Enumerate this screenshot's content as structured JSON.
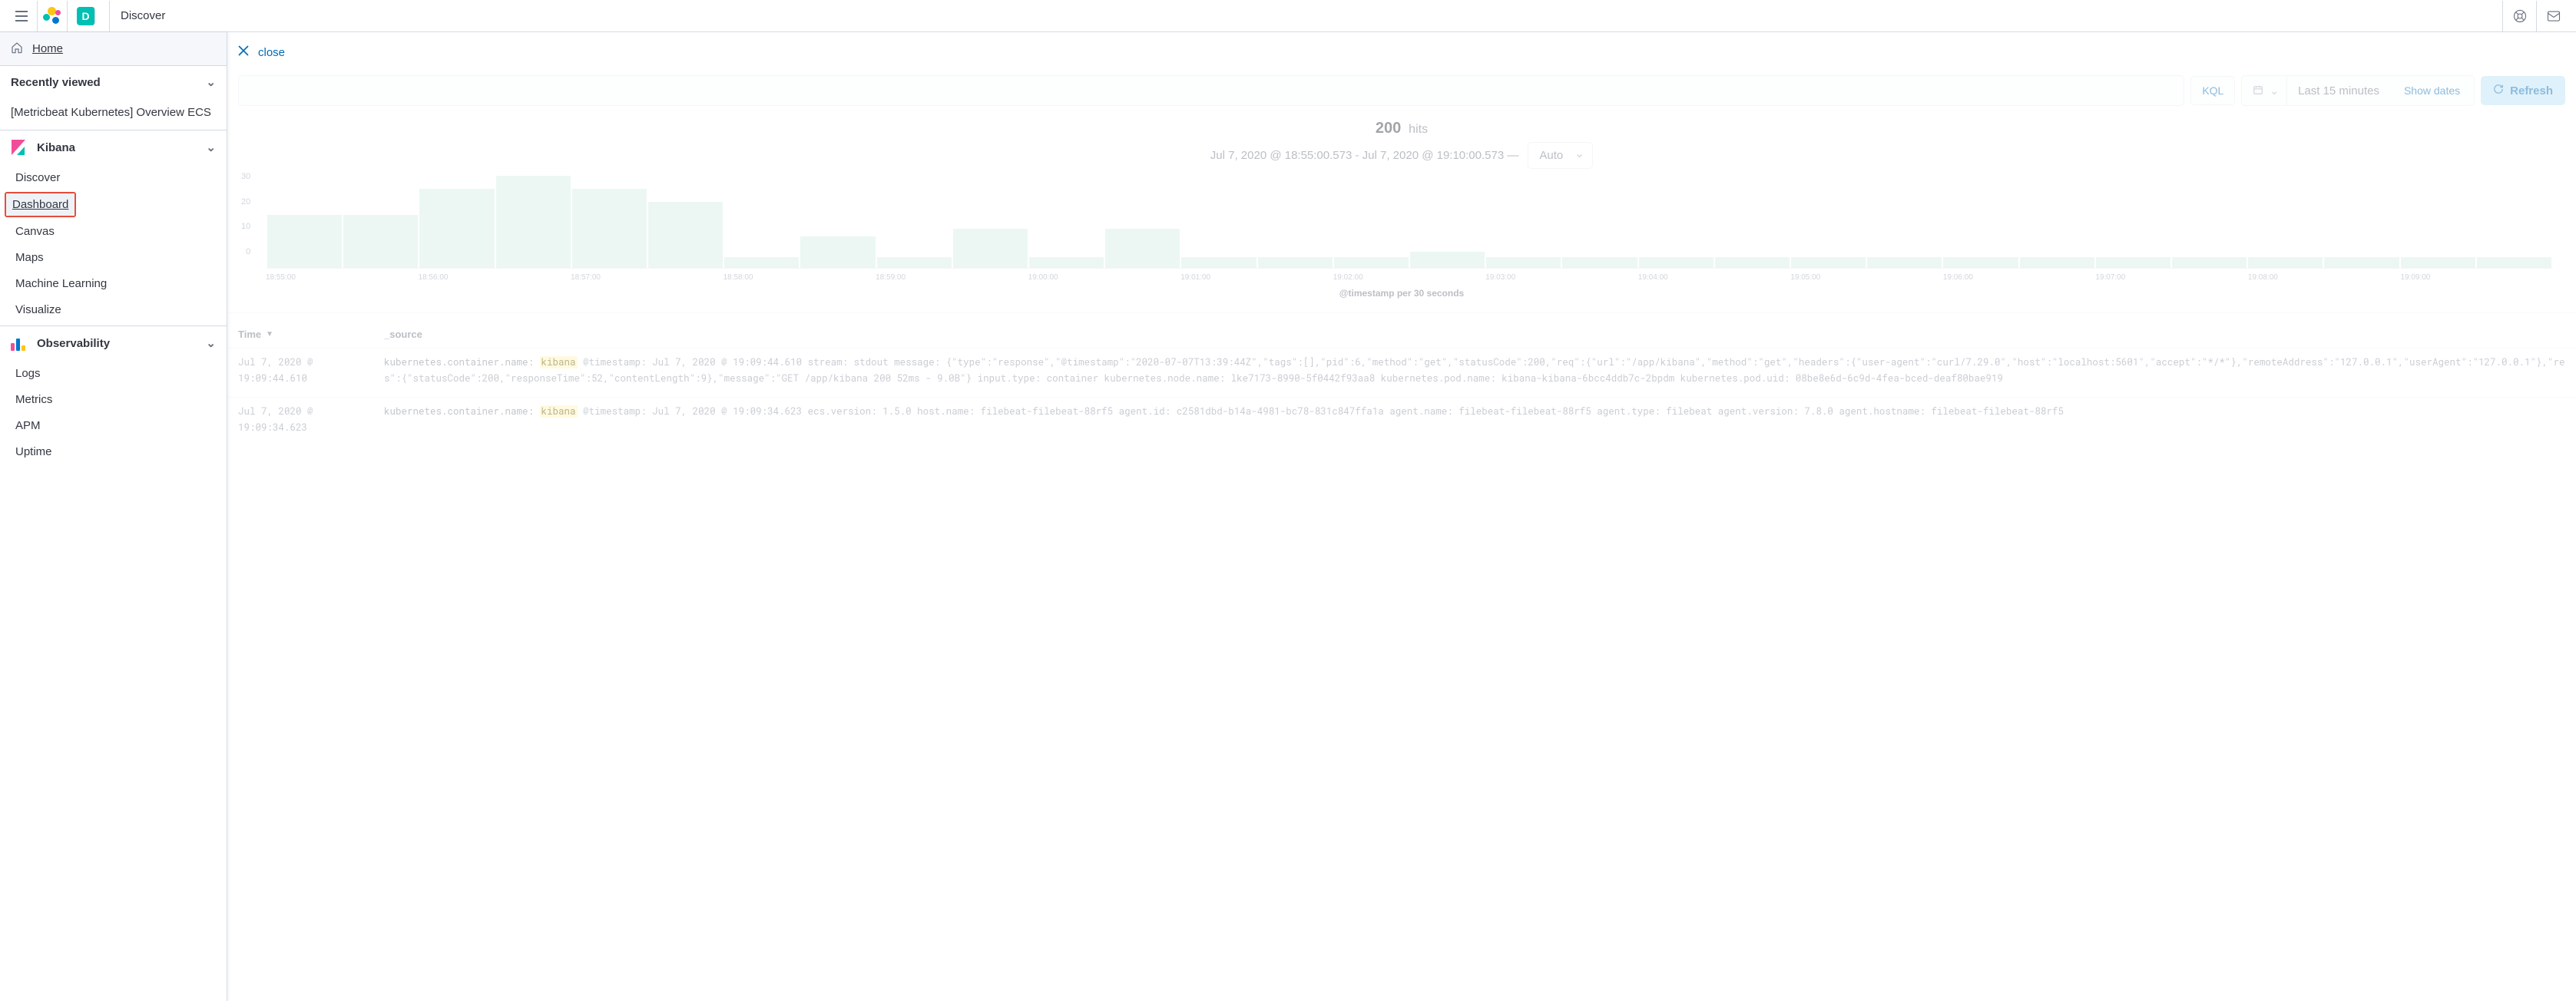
{
  "header": {
    "app_badge": "D",
    "app_name": "Discover"
  },
  "sidebar": {
    "home": "Home",
    "recently_viewed_label": "Recently viewed",
    "recent_items": [
      "[Metricbeat Kubernetes] Overview ECS"
    ],
    "kibana_label": "Kibana",
    "kibana_items": [
      "Discover",
      "Dashboard",
      "Canvas",
      "Maps",
      "Machine Learning",
      "Visualize"
    ],
    "observability_label": "Observability",
    "observability_items": [
      "Logs",
      "Metrics",
      "APM",
      "Uptime"
    ]
  },
  "close_label": "close",
  "query_bar": {
    "kql": "KQL",
    "time_text": "Last 15 minutes",
    "show_dates": "Show dates",
    "refresh": "Refresh"
  },
  "hits": {
    "count": "200",
    "label": "hits"
  },
  "range": {
    "text": "Jul 7, 2020 @ 18:55:00.573 - Jul 7, 2020 @ 19:10:00.573 —",
    "interval": "Auto"
  },
  "chart_data": {
    "type": "bar",
    "title": "",
    "xlabel": "@timestamp per 30 seconds",
    "ylabel": "",
    "ylim": [
      0,
      35
    ],
    "y_ticks": [
      "30",
      "20",
      "10",
      "0"
    ],
    "x_ticks": [
      "18:55:00",
      "18:56:00",
      "18:57:00",
      "18:58:00",
      "18:59:00",
      "19:00:00",
      "19:01:00",
      "19:02:00",
      "19:03:00",
      "19:04:00",
      "19:05:00",
      "19:06:00",
      "19:07:00",
      "19:08:00",
      "19:09:00"
    ],
    "values": [
      20,
      20,
      30,
      35,
      30,
      25,
      4,
      12,
      4,
      15,
      4,
      15,
      4,
      4,
      4,
      6,
      4,
      4,
      4,
      4,
      4,
      4,
      4,
      4,
      4,
      4,
      4,
      4,
      4,
      4
    ]
  },
  "table": {
    "col_time": "Time",
    "col_source": "_source",
    "rows": [
      {
        "time": "Jul 7, 2020 @ 19:09:44.610",
        "source_parts": [
          {
            "t": "field",
            "v": "kubernetes.container.name: "
          },
          {
            "t": "hl",
            "v": "kibana"
          },
          {
            "t": "plain",
            "v": "  @timestamp: Jul 7, 2020 @ 19:09:44.610  stream: stdout  message: {\"type\":\"response\",\"@timestamp\":\"2020-07-07T13:39:44Z\",\"tags\":[],\"pid\":6,\"method\":\"get\",\"statusCode\":200,\"req\":{\"url\":\"/app/kibana\",\"method\":\"get\",\"headers\":{\"user-agent\":\"curl/7.29.0\",\"host\":\"localhost:5601\",\"accept\":\"*/*\"},\"remoteAddress\":\"127.0.0.1\",\"userAgent\":\"127.0.0.1\"},\"res\":{\"statusCode\":200,\"responseTime\":52,\"contentLength\":9},\"message\":\"GET /app/kibana 200 52ms - 9.0B\"}  input.type: container kubernetes.node.name: lke7173-8990-5f0442f93aa8  kubernetes.pod.name: kibana-kibana-6bcc4ddb7c-2bpdm  kubernetes.pod.uid: 08be8e6d-6c9d-4fea-bced-deaf80bae919"
          }
        ]
      },
      {
        "time": "Jul 7, 2020 @ 19:09:34.623",
        "source_parts": [
          {
            "t": "field",
            "v": "kubernetes.container.name: "
          },
          {
            "t": "hl",
            "v": "kibana"
          },
          {
            "t": "plain",
            "v": "  @timestamp: Jul 7, 2020 @ 19:09:34.623  ecs.version: 1.5.0  host.name: filebeat-filebeat-88rf5  agent.id: c2581dbd-b14a-4981-bc78-831c847ffa1a  agent.name: filebeat-filebeat-88rf5  agent.type: filebeat  agent.version: 7.8.0  agent.hostname: filebeat-filebeat-88rf5"
          }
        ]
      }
    ]
  }
}
